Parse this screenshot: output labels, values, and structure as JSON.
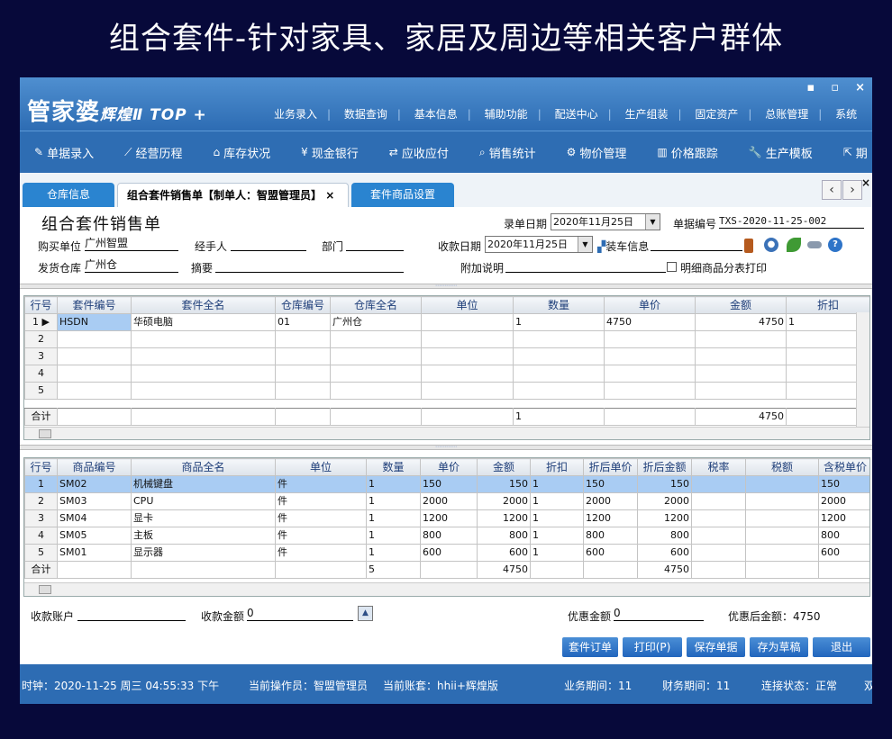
{
  "banner": "组合套件-针对家具、家居及周边等相关客户群体",
  "app": {
    "logo_main": "管家婆",
    "logo_sub": "辉煌Ⅱ TOP +",
    "menu": [
      "业务录入",
      "数据查询",
      "基本信息",
      "辅助功能",
      "配送中心",
      "生产组装",
      "固定资产",
      "总账管理",
      "系统"
    ],
    "window_buttons": [
      "▪",
      "▫",
      "×"
    ]
  },
  "toolbar": [
    {
      "label": "单据录入",
      "icon": "document-edit-icon",
      "glyph": "✎"
    },
    {
      "label": "经营历程",
      "icon": "line-chart-icon",
      "glyph": "⟋"
    },
    {
      "label": "库存状况",
      "icon": "house-icon",
      "glyph": "⌂"
    },
    {
      "label": "现金银行",
      "icon": "yen-icon",
      "glyph": "¥"
    },
    {
      "label": "应收应付",
      "icon": "transfer-arrows-icon",
      "glyph": "⇄"
    },
    {
      "label": "销售统计",
      "icon": "search-icon",
      "glyph": "⌕"
    },
    {
      "label": "物价管理",
      "icon": "gear-icon",
      "glyph": "⚙"
    },
    {
      "label": "价格跟踪",
      "icon": "bar-chart-icon",
      "glyph": "▥"
    },
    {
      "label": "生产模板",
      "icon": "wrench-icon",
      "glyph": "🔧"
    },
    {
      "label": "期",
      "icon": "export-icon",
      "glyph": "⇱"
    }
  ],
  "tabs": [
    "仓库信息",
    "组合套件销售单【制单人：智盟管理员】",
    "套件商品设置"
  ],
  "tab_close": "×",
  "nav": {
    "prev": "‹",
    "next": "›",
    "close": "×"
  },
  "form": {
    "title": "组合套件销售单",
    "record_date_label": "录单日期",
    "record_date": "2020年11月25日",
    "doc_no_label": "单据编号",
    "doc_no": "TXS-2020-11-25-002",
    "buyer_label": "购买单位",
    "buyer": "广州智盟",
    "handler_label": "经手人",
    "handler": "",
    "dept_label": "部门",
    "dept": "",
    "receipt_date_label": "收款日期",
    "receipt_date": "2020年11月25日",
    "loading_label": "装车信息",
    "loading": "",
    "warehouse_label": "发货仓库",
    "warehouse": "广州仓",
    "summary_label": "摘要",
    "summary": "",
    "extra_label": "附加说明",
    "extra": "",
    "detail_print_label": "明细商品分表打印"
  },
  "grid1": {
    "headers": [
      "行号",
      "套件编号",
      "套件全名",
      "仓库编号",
      "仓库全名",
      "单位",
      "数量",
      "单价",
      "金额",
      "折扣"
    ],
    "rows": [
      [
        "1",
        "HSDN",
        "华硕电脑",
        "01",
        "广州仓",
        "",
        "1",
        "4750",
        "4750",
        "1"
      ],
      [
        "2",
        "",
        "",
        "",
        "",
        "",
        "",
        "",
        "",
        ""
      ],
      [
        "3",
        "",
        "",
        "",
        "",
        "",
        "",
        "",
        "",
        ""
      ],
      [
        "4",
        "",
        "",
        "",
        "",
        "",
        "",
        "",
        "",
        ""
      ],
      [
        "5",
        "",
        "",
        "",
        "",
        "",
        "",
        "",
        "",
        ""
      ]
    ],
    "total": [
      "合计",
      "",
      "",
      "",
      "",
      "",
      "1",
      "",
      "4750",
      ""
    ]
  },
  "grid2": {
    "headers": [
      "行号",
      "商品编号",
      "商品全名",
      "单位",
      "数量",
      "单价",
      "金额",
      "折扣",
      "折后单价",
      "折后金额",
      "税率",
      "税额",
      "含税单价"
    ],
    "rows": [
      [
        "1",
        "SM02",
        "机械键盘",
        "件",
        "1",
        "150",
        "150",
        "1",
        "150",
        "150",
        "",
        "",
        "150"
      ],
      [
        "2",
        "SM03",
        "CPU",
        "件",
        "1",
        "2000",
        "2000",
        "1",
        "2000",
        "2000",
        "",
        "",
        "2000"
      ],
      [
        "3",
        "SM04",
        "显卡",
        "件",
        "1",
        "1200",
        "1200",
        "1",
        "1200",
        "1200",
        "",
        "",
        "1200"
      ],
      [
        "4",
        "SM05",
        "主板",
        "件",
        "1",
        "800",
        "800",
        "1",
        "800",
        "800",
        "",
        "",
        "800"
      ],
      [
        "5",
        "SM01",
        "显示器",
        "件",
        "1",
        "600",
        "600",
        "1",
        "600",
        "600",
        "",
        "",
        "600"
      ]
    ],
    "total": [
      "合计",
      "",
      "",
      "",
      "5",
      "",
      "4750",
      "",
      "",
      "4750",
      "",
      "",
      ""
    ]
  },
  "footer": {
    "account_label": "收款账户",
    "account": "",
    "amount_label": "收款金额",
    "amount": "0",
    "discount_label": "优惠金额",
    "discount": "0",
    "after_label": "优惠后金额：",
    "after": "4750"
  },
  "buttons": [
    "套件订单",
    "打印(P)",
    "保存单据",
    "存为草稿",
    "退出"
  ],
  "status": [
    "时钟：2020-11-25 周三 04:55:33 下午",
    "当前操作员：智盟管理员",
    "当前账套：hhii+辉煌版",
    "业务期间：11",
    "财务期间：11",
    "连接状态：正常",
    "双"
  ]
}
